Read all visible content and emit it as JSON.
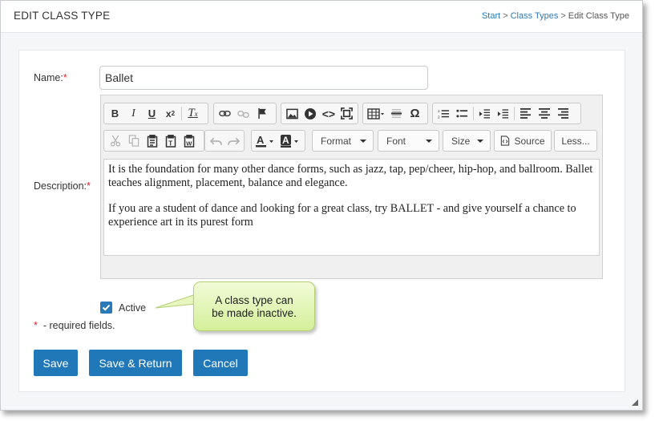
{
  "header": {
    "title": "EDIT CLASS TYPE",
    "breadcrumb": {
      "start": "Start",
      "sep1": ">",
      "class_types": "Class Types",
      "sep2": ">",
      "current": "Edit Class Type"
    }
  },
  "form": {
    "name_label": "Name:",
    "required_mark": "*",
    "name_value": "Ballet",
    "description_label": "Description:",
    "description_paragraphs": [
      "It is the foundation for many other dance forms, such as jazz, tap, pep/cheer, hip-hop, and ballroom. Ballet teaches alignment, placement, balance and elegance.",
      "If you are a student of dance and looking for a great class, try BALLET - and give yourself a chance to experience art in its purest form"
    ],
    "active_label": "Active",
    "active_checked": true,
    "required_note": "- required fields."
  },
  "toolbar": {
    "row1": [
      {
        "name": "bold",
        "glyph": "B"
      },
      {
        "name": "italic",
        "glyph": "I"
      },
      {
        "name": "underline",
        "glyph": "U"
      },
      {
        "name": "superscript",
        "glyph": "x²"
      },
      {
        "name": "remove-format",
        "glyph": "Tx"
      },
      {
        "name": "link",
        "glyph": "link"
      },
      {
        "name": "unlink",
        "glyph": "unlink"
      },
      {
        "name": "anchor",
        "glyph": "flag"
      },
      {
        "name": "image",
        "glyph": "image"
      },
      {
        "name": "video",
        "glyph": "play"
      },
      {
        "name": "source-code",
        "glyph": "<>"
      },
      {
        "name": "maximize",
        "glyph": "maximize"
      },
      {
        "name": "table",
        "glyph": "table"
      },
      {
        "name": "horizontal-line",
        "glyph": "hr"
      },
      {
        "name": "special-char",
        "glyph": "Ω"
      },
      {
        "name": "numbered-list",
        "glyph": "ol"
      },
      {
        "name": "bulleted-list",
        "glyph": "ul"
      },
      {
        "name": "outdent",
        "glyph": "outdent"
      },
      {
        "name": "indent",
        "glyph": "indent"
      },
      {
        "name": "align-left",
        "glyph": "left"
      },
      {
        "name": "align-center",
        "glyph": "center"
      },
      {
        "name": "align-right",
        "glyph": "right"
      }
    ],
    "format_label": "Format",
    "font_label": "Font",
    "size_label": "Size",
    "source_label": "Source",
    "less_label": "Less..."
  },
  "callout": {
    "line1": "A class type can",
    "line2": "be made inactive."
  },
  "buttons": {
    "save": "Save",
    "save_return": "Save & Return",
    "cancel": "Cancel"
  },
  "colors": {
    "primary": "#2178b8",
    "required": "#d9232d",
    "link": "#2a7ab8",
    "callout": "#d4ef9a"
  }
}
